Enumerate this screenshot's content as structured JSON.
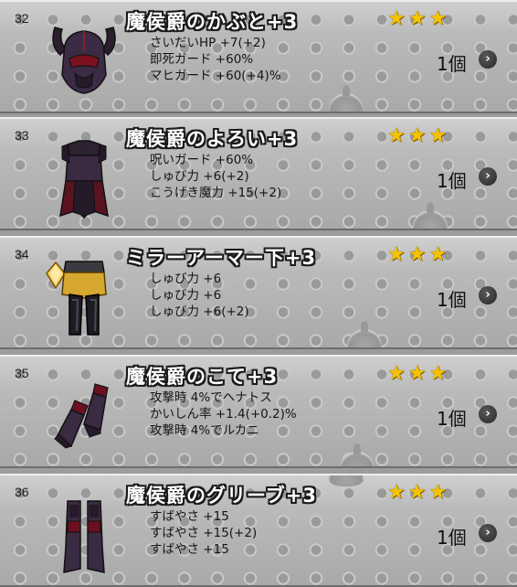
{
  "items": [
    {
      "number": "32",
      "name": "魔侯爵のかぶと+3",
      "stars": [
        "★",
        "★",
        "★"
      ],
      "icon": "dark-helmet-icon",
      "stats": [
        "さいだいHP +7(+2)",
        "即死ガード +60%",
        "マヒガード +60(+4)%"
      ],
      "count": "1個",
      "has_gem": false
    },
    {
      "number": "33",
      "name": "魔侯爵のよろい+3",
      "stars": [
        "★",
        "★",
        "★"
      ],
      "icon": "dark-armor-icon",
      "stats": [
        "呪いガード +60%",
        "しゅび力 +6(+2)",
        "こうげき魔力 +15(+2)"
      ],
      "count": "1個",
      "has_gem": false
    },
    {
      "number": "34",
      "name": "ミラーアーマー下+3",
      "stars": [
        "★",
        "★",
        "★"
      ],
      "icon": "mirror-leg-armor-icon",
      "stats": [
        "しゅび力 +6",
        "しゅび力 +6",
        "しゅび力 +6(+2)"
      ],
      "count": "1個",
      "has_gem": true
    },
    {
      "number": "35",
      "name": "魔侯爵のこて+3",
      "stars": [
        "★",
        "★",
        "★"
      ],
      "icon": "dark-gauntlet-icon",
      "stats": [
        "攻撃時 4%でヘナトス",
        "かいしん率 +1.4(+0.2)%",
        "攻撃時 4%でルカニ"
      ],
      "count": "1個",
      "has_gem": false
    },
    {
      "number": "36",
      "name": "魔侯爵のグリーブ+3",
      "stars": [
        "★",
        "★",
        "★"
      ],
      "icon": "dark-greaves-icon",
      "stats": [
        "すばやさ +15",
        "すばやさ +15(+2)",
        "すばやさ +15"
      ],
      "count": "1個",
      "has_gem": false
    }
  ],
  "arrow_glyph": "›",
  "colors": {
    "star": "#f5c400",
    "name_text": "#ffffff",
    "name_outline": "#1a1a1a",
    "panel": "#b8b8b8"
  }
}
